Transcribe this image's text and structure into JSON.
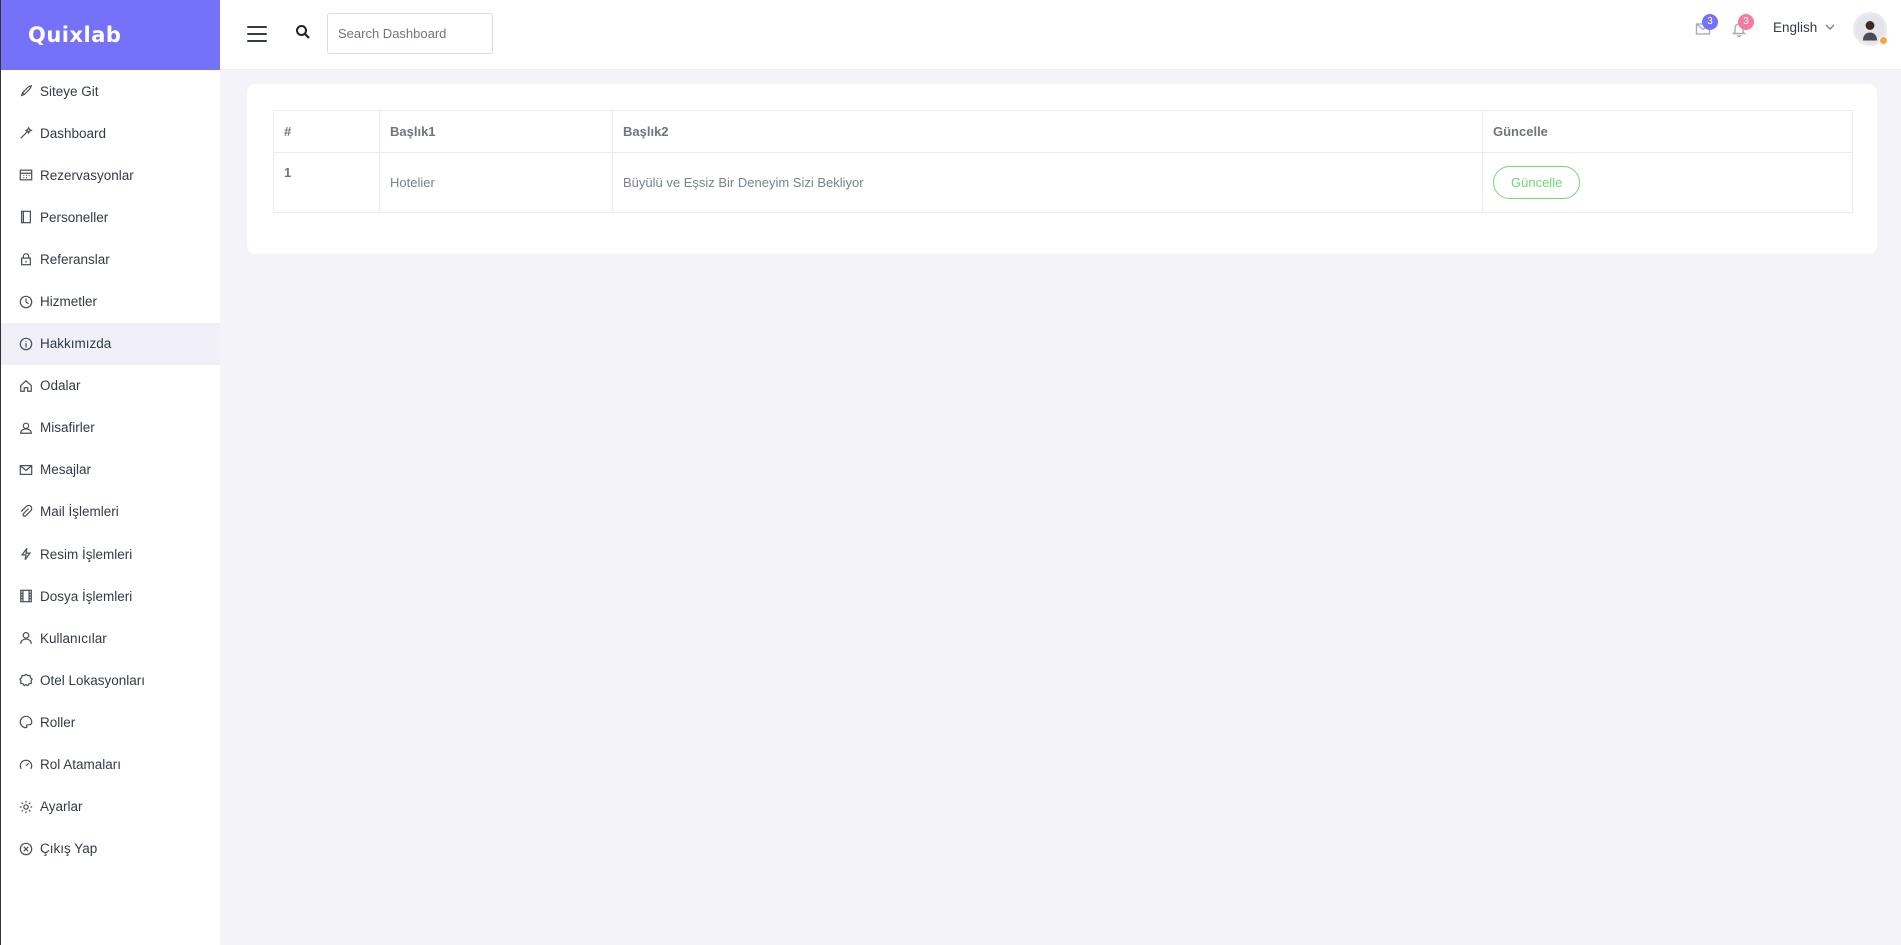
{
  "brand": {
    "name": "Quixlab",
    "color": "#7571f9"
  },
  "sidebar": {
    "items": [
      {
        "label": "Siteye Git",
        "icon": "rocket-icon"
      },
      {
        "label": "Dashboard",
        "icon": "magic-wand-icon"
      },
      {
        "label": "Rezervasyonlar",
        "icon": "calendar-icon"
      },
      {
        "label": "Personeller",
        "icon": "notebook-icon"
      },
      {
        "label": "Referanslar",
        "icon": "lock-icon"
      },
      {
        "label": "Hizmetler",
        "icon": "clock-icon"
      },
      {
        "label": "Hakkımızda",
        "icon": "info-icon",
        "active": true
      },
      {
        "label": "Odalar",
        "icon": "home-icon"
      },
      {
        "label": "Misafirler",
        "icon": "users-icon"
      },
      {
        "label": "Mesajlar",
        "icon": "envelope-icon"
      },
      {
        "label": "Mail İşlemleri",
        "icon": "paperclip-icon"
      },
      {
        "label": "Resim İşlemleri",
        "icon": "lightning-icon"
      },
      {
        "label": "Dosya İşlemleri",
        "icon": "film-icon"
      },
      {
        "label": "Kullanıcılar",
        "icon": "user-icon"
      },
      {
        "label": "Otel Lokasyonları",
        "icon": "badge-icon"
      },
      {
        "label": "Roller",
        "icon": "palette-icon"
      },
      {
        "label": "Rol Atamaları",
        "icon": "speedometer-icon"
      },
      {
        "label": "Ayarlar",
        "icon": "gear-icon"
      },
      {
        "label": "Çıkış Yap",
        "icon": "close-circle-icon"
      }
    ]
  },
  "header": {
    "search_placeholder": "Search Dashboard",
    "messages_count": "3",
    "messages_badge_color": "#7571f9",
    "notifications_count": "3",
    "notifications_badge_color": "#f87aa0",
    "language": "English"
  },
  "table": {
    "headers": [
      "#",
      "Başlık1",
      "Başlık2",
      "Güncelle"
    ],
    "rows": [
      {
        "id": "1",
        "title1": "Hotelier",
        "title2": "Büyülü ve Eşsiz Bir Deneyim Sizi Bekliyor",
        "action_label": "Güncelle"
      }
    ]
  }
}
